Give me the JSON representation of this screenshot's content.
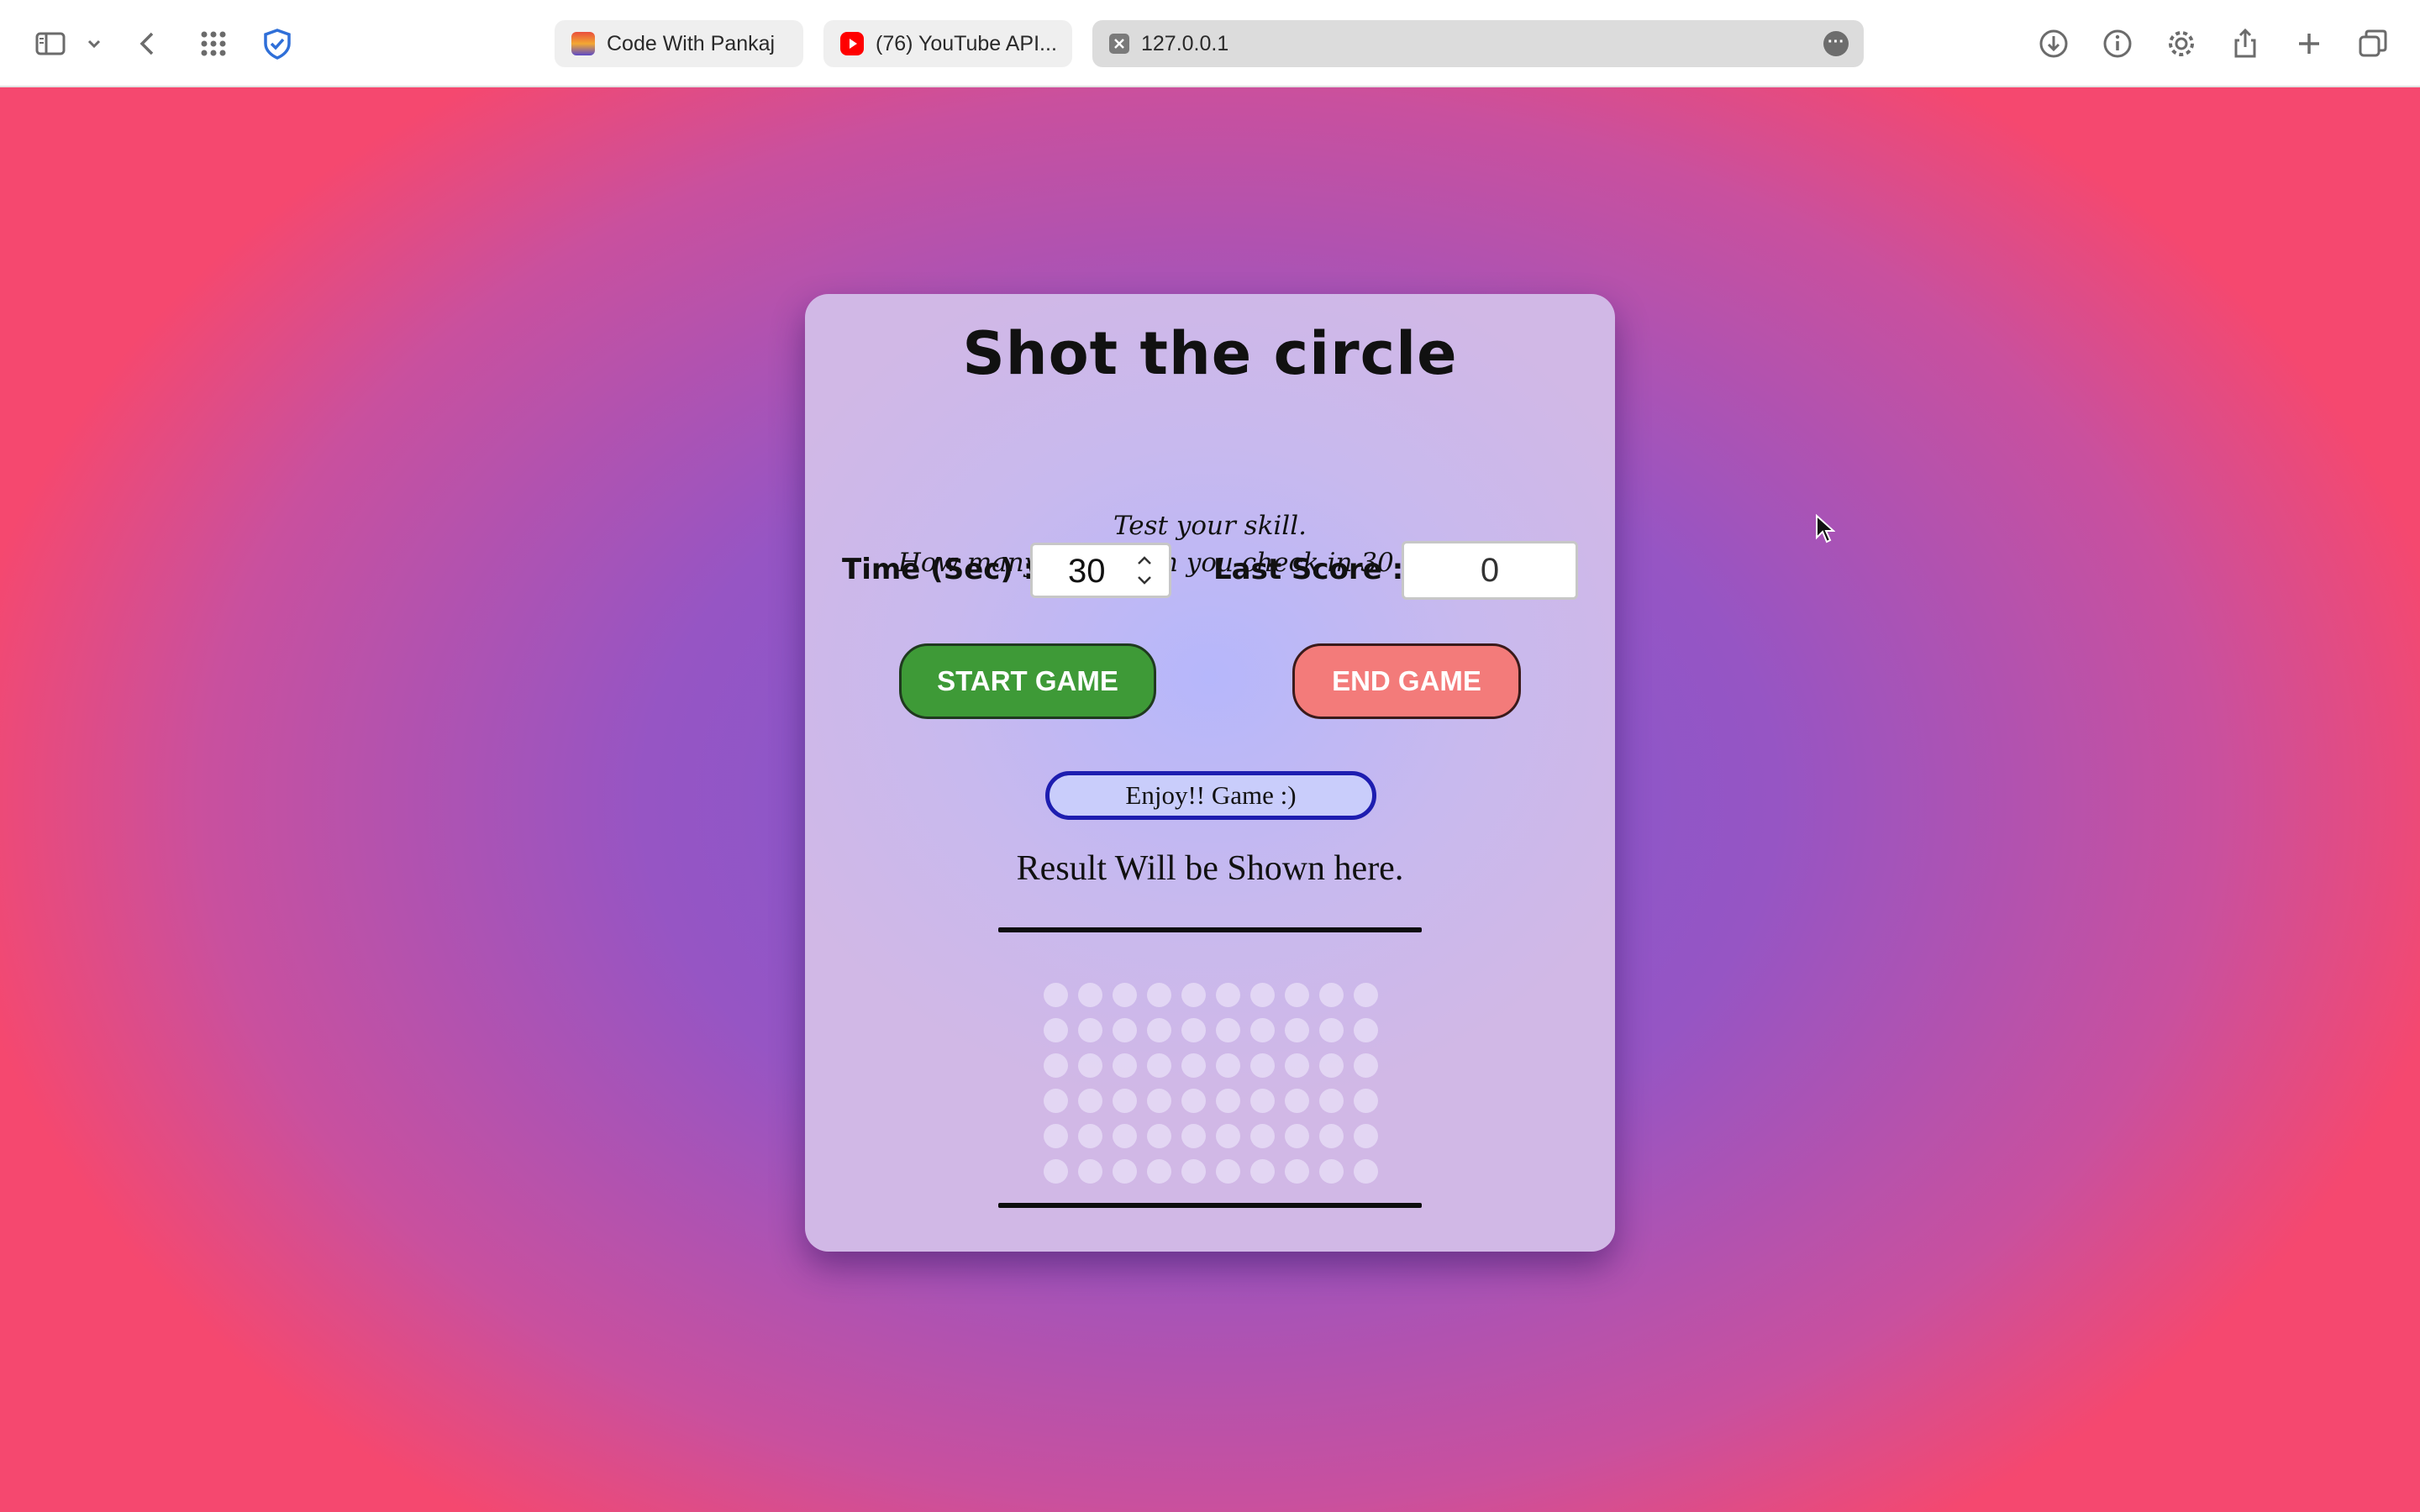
{
  "browser": {
    "tabs": [
      {
        "label": "Code With Pankaj"
      },
      {
        "label": "(76) YouTube API..."
      }
    ],
    "address": "127.0.0.1",
    "icons": [
      "sidebar-icon",
      "chevron-down-icon",
      "back-icon",
      "grid-icon",
      "shield-icon",
      "download-icon",
      "info-icon",
      "gear-icon",
      "share-icon",
      "plus-icon",
      "tabs-overview-icon"
    ]
  },
  "game": {
    "title": "Shot the circle",
    "subtitle_line1": "Test your skill.",
    "subtitle_line2": "How many boxes can you check in 30 seconds?",
    "time_label": "Time (Sec) :",
    "time_value": "30",
    "last_score_label": "Last Score :",
    "last_score_value": "0",
    "start_button": "START GAME",
    "end_button": "END GAME",
    "status": "Enjoy!! Game :)",
    "result": "Result Will be Shown here.",
    "circles": {
      "rows": 6,
      "cols": 10
    }
  },
  "colors": {
    "start_button": "#3e9a37",
    "end_button": "#f37b7a",
    "status_border": "#1d1db0"
  }
}
